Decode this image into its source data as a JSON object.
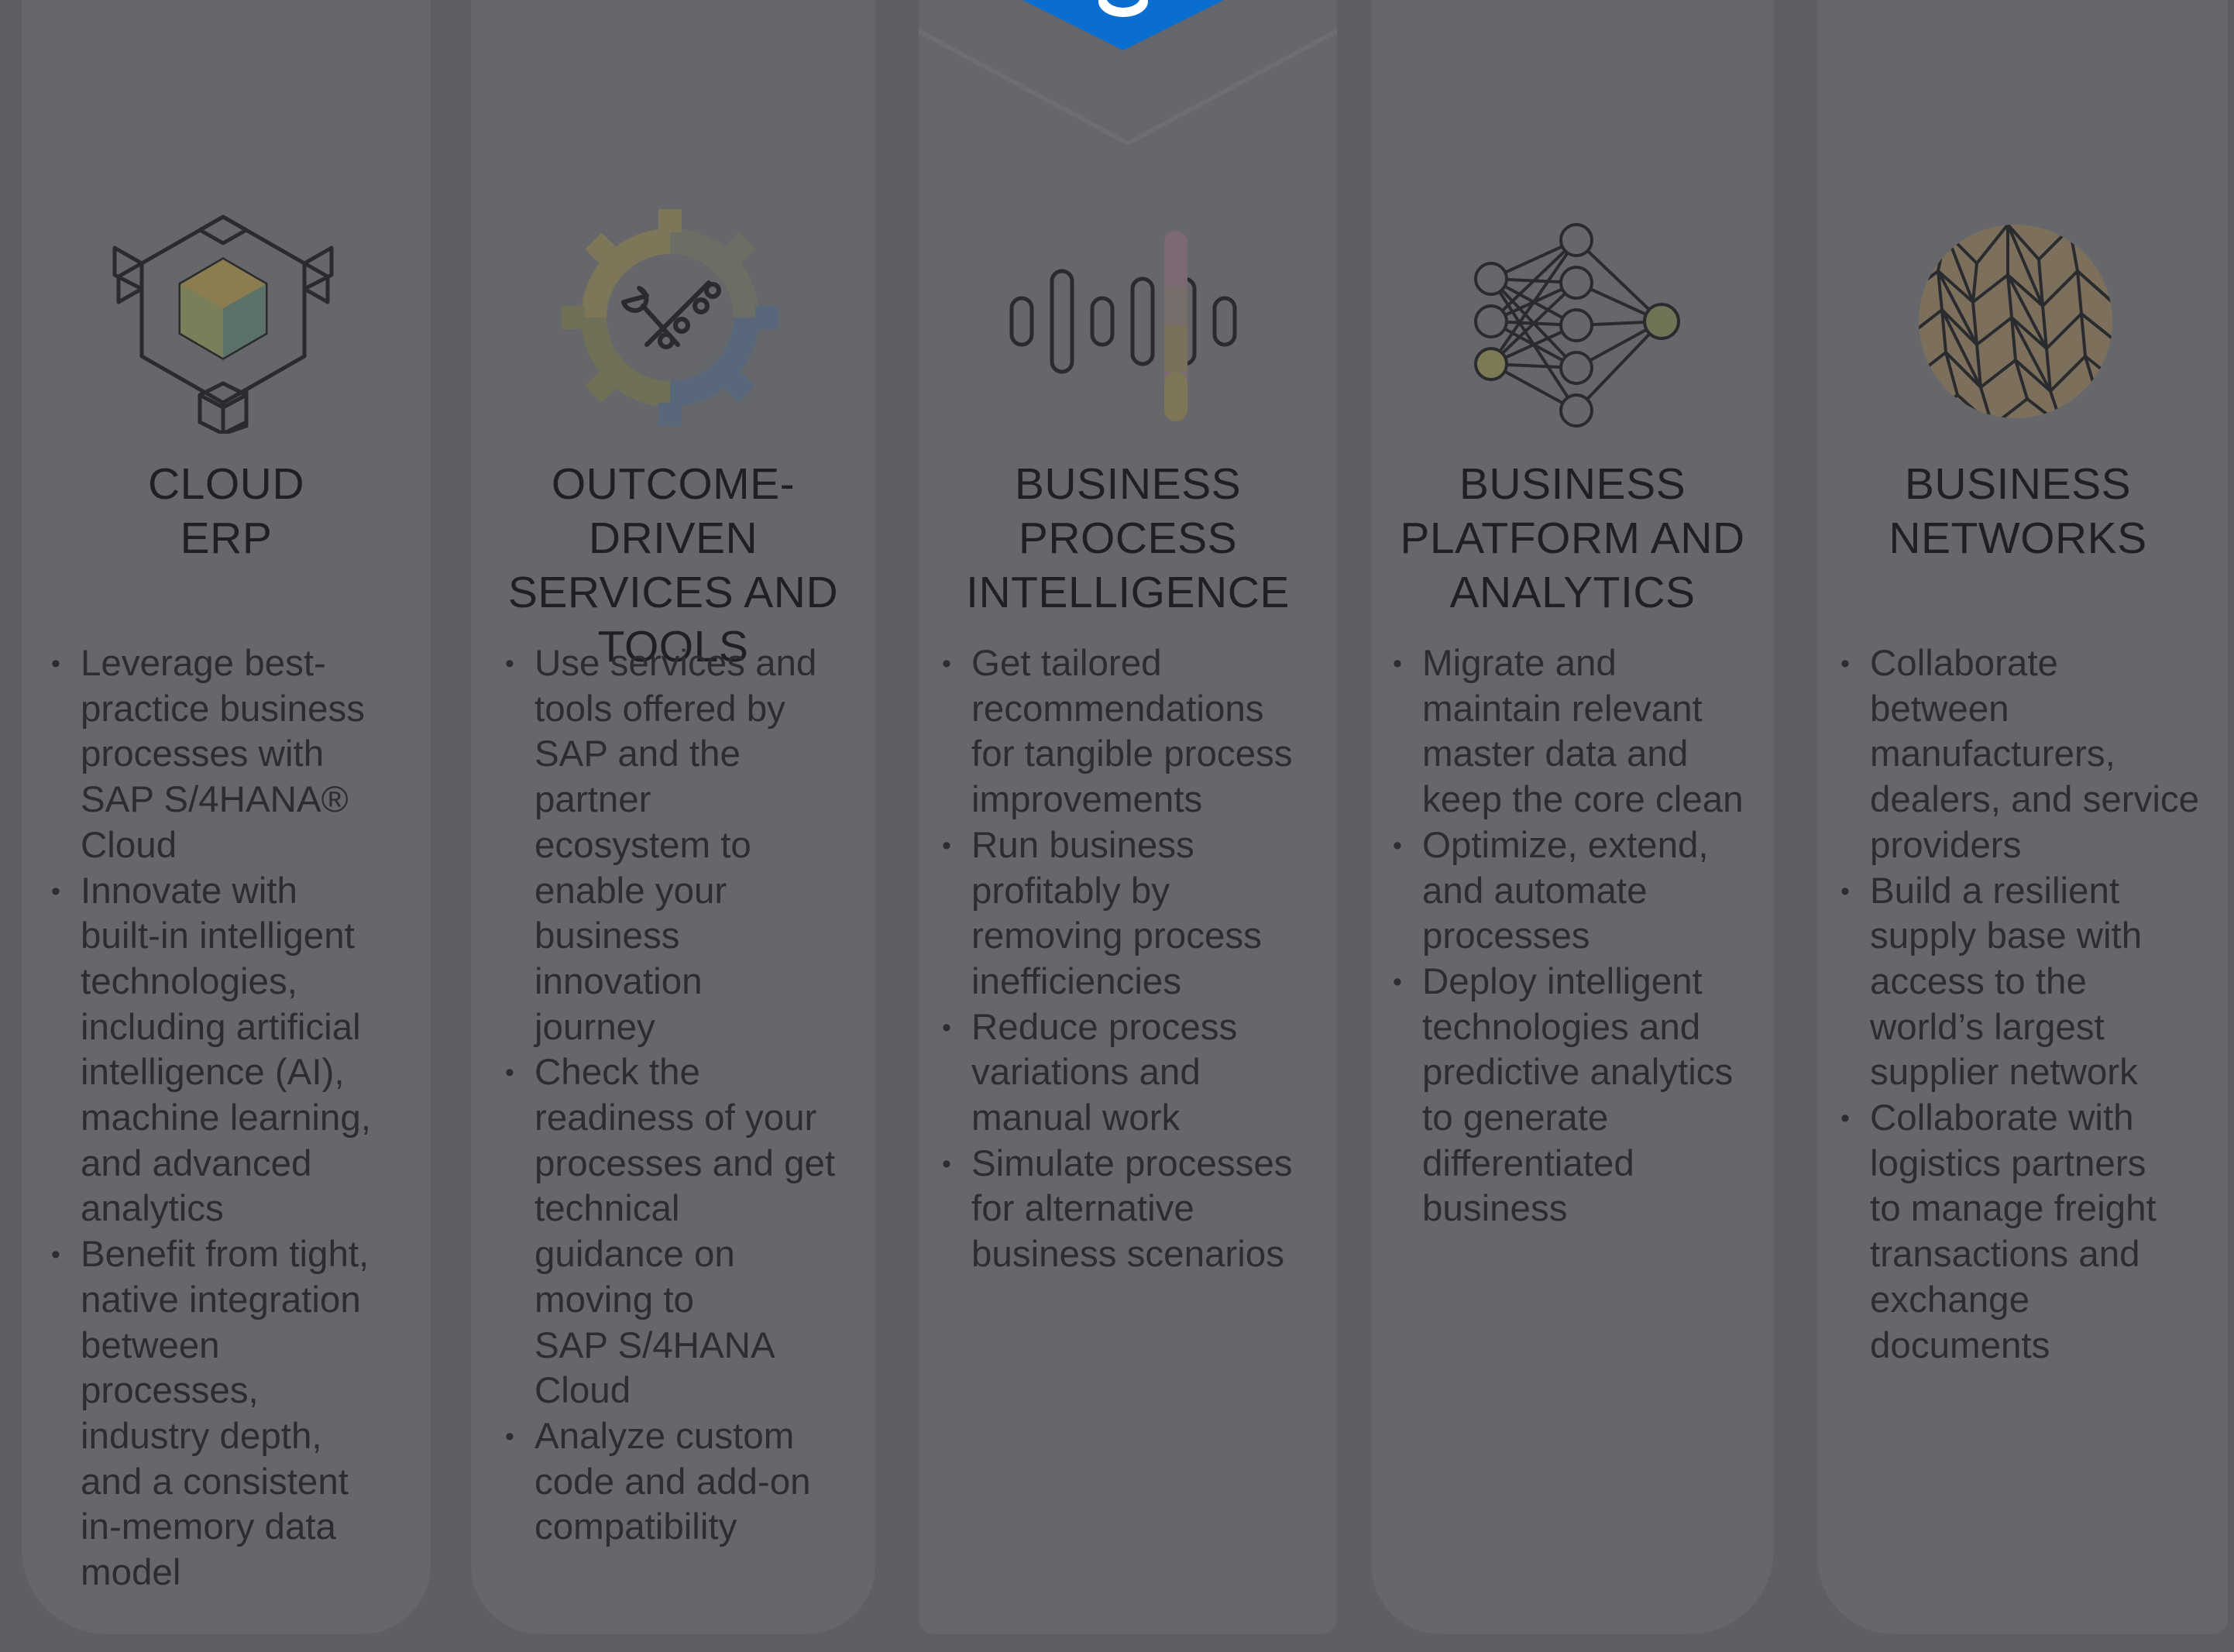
{
  "colors": {
    "background": "#5e5f63",
    "column": "#66676a",
    "text": "#2c2d30",
    "emblem": "#0a6ed1"
  },
  "columns": [
    {
      "icon": "cube-network-icon",
      "title_lines": [
        "CLOUD",
        "ERP"
      ],
      "bullets": [
        {
          "lines": [
            "Leverage best-",
            "practice business",
            "processes with",
            "SAP S/4HANA® ",
            "Cloud"
          ]
        },
        {
          "lines": [
            "Innovate with",
            "built-in intelligent",
            "technologies,",
            "including artificial",
            "intelligence (AI),",
            "machine learning,",
            "and advanced",
            "analytics"
          ]
        },
        {
          "lines": [
            "Benefit from tight,",
            "native integration",
            "between",
            "processes,",
            "industry depth,",
            "and a consistent",
            "in-memory data",
            "model"
          ]
        }
      ]
    },
    {
      "icon": "gear-tools-icon",
      "title_lines": [
        "OUTCOME-DRIVEN",
        "SERVICES AND",
        "TOOLS"
      ],
      "bullets": [
        {
          "lines": [
            "Use services and",
            "tools offered by",
            "SAP and the",
            "partner",
            "ecosystem to",
            "enable your",
            "business",
            "innovation",
            "journey"
          ]
        },
        {
          "lines": [
            "Check the",
            "readiness of your",
            "processes and get",
            "technical",
            "guidance on",
            "moving to",
            "SAP S/4HANA",
            "Cloud"
          ]
        },
        {
          "lines": [
            "Analyze custom",
            "code and add-on",
            "compatibility"
          ]
        }
      ]
    },
    {
      "icon": "audio-bars-icon",
      "title_lines": [
        "BUSINESS",
        "PROCESS",
        "INTELLIGENCE"
      ],
      "bullets": [
        {
          "lines": [
            "Get tailored",
            "recommendations",
            "for tangible process",
            "improvements"
          ]
        },
        {
          "lines": [
            "Run business",
            "profitably by",
            "removing process",
            "inefficiencies"
          ]
        },
        {
          "lines": [
            "Reduce process",
            "variations and",
            "manual work"
          ]
        },
        {
          "lines": [
            "Simulate processes",
            "for alternative",
            "business scenarios"
          ]
        }
      ]
    },
    {
      "icon": "neural-network-icon",
      "title_lines": [
        "BUSINESS",
        "PLATFORM AND",
        "ANALYTICS"
      ],
      "bullets": [
        {
          "lines": [
            "Migrate and",
            "maintain relevant",
            "master data and",
            "keep the core clean"
          ]
        },
        {
          "lines": [
            "Optimize, extend,",
            "and automate",
            "processes"
          ]
        },
        {
          "lines": [
            "Deploy intelligent",
            "technologies and",
            "predictive analytics",
            "to generate",
            "differentiated",
            "business"
          ]
        }
      ]
    },
    {
      "icon": "network-globe-icon",
      "title_lines": [
        "BUSINESS",
        "NETWORKS"
      ],
      "bullets": [
        {
          "lines": [
            "Collaborate",
            "between",
            "manufacturers,",
            "dealers, and service",
            "providers"
          ]
        },
        {
          "lines": [
            "Build a resilient",
            "supply base with",
            "access to the",
            "world’s largest",
            "supplier network"
          ]
        },
        {
          "lines": [
            "Collaborate with",
            "logistics partners",
            "to manage freight",
            "transactions and",
            "exchange",
            "documents"
          ]
        }
      ]
    }
  ]
}
